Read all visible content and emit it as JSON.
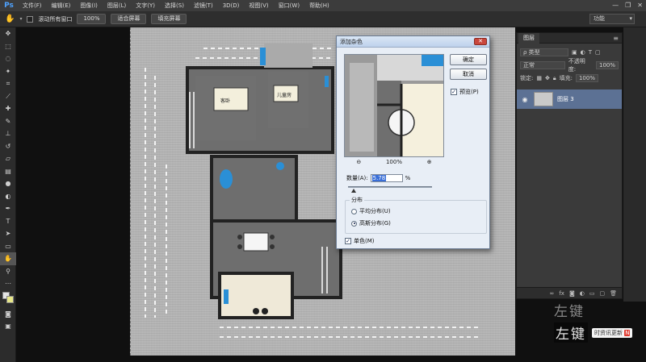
{
  "app": {
    "logo": "Ps"
  },
  "menu": [
    "文件(F)",
    "编辑(E)",
    "图像(I)",
    "图层(L)",
    "文字(Y)",
    "选择(S)",
    "滤镜(T)",
    "3D(D)",
    "视图(V)",
    "窗口(W)",
    "帮助(H)"
  ],
  "window_controls": {
    "minimize": "—",
    "restore": "❐",
    "close": "✕"
  },
  "options": {
    "scroll_all_windows": "滚动所有窗口",
    "zoom_100": "100%",
    "fit_screen": "适合屏幕",
    "fill_screen": "填充屏幕",
    "workspace": "功能"
  },
  "dialog": {
    "title": "添加杂色",
    "ok": "确定",
    "cancel": "取消",
    "preview_label": "预览(P)",
    "zoom_level": "100%",
    "amount_label": "数量(A):",
    "amount_value": "5.78",
    "amount_unit": "%",
    "amount_fraction": 0.0578,
    "distribution_label": "分布",
    "uniform": "平均分布(U)",
    "gaussian": "高斯分布(G)",
    "monochromatic": "单色(M)",
    "preview_checked": true,
    "gaussian_selected": true,
    "monochromatic_checked": true
  },
  "layers_panel": {
    "tab": "图层",
    "filter_kind": "ρ 类型",
    "blend_mode": "正常",
    "opacity_label": "不透明度:",
    "opacity_value": "100%",
    "lock_label": "锁定:",
    "fill_label": "填充:",
    "fill_value": "100%",
    "layer_name": "图层 3"
  },
  "floorplan": {
    "room_master": "客卧",
    "room_child": "儿童房"
  },
  "watermark": {
    "line1": "左键",
    "line2": "左键",
    "tag": "时资讯更新",
    "badge": "N"
  },
  "colors": {
    "accent_blue": "#2a8fd6",
    "selection_blue": "#5c7194",
    "dialog_bg": "#e8eef6"
  }
}
